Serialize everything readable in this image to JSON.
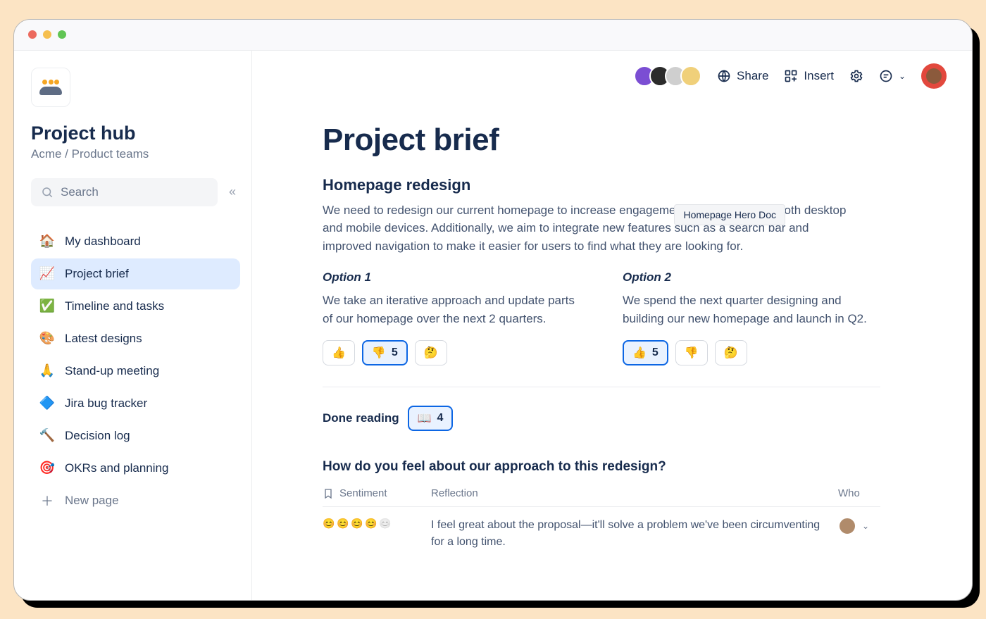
{
  "workspace": {
    "title": "Project hub",
    "breadcrumb": "Acme / Product teams"
  },
  "search": {
    "placeholder": "Search"
  },
  "nav": {
    "items": [
      {
        "icon": "🏠",
        "label": "My dashboard"
      },
      {
        "icon": "📈",
        "label": "Project brief"
      },
      {
        "icon": "✅",
        "label": "Timeline and tasks"
      },
      {
        "icon": "🎨",
        "label": "Latest designs"
      },
      {
        "icon": "🙏",
        "label": "Stand-up meeting"
      },
      {
        "icon": "🔷",
        "label": "Jira bug tracker"
      },
      {
        "icon": "🔨",
        "label": "Decision log"
      },
      {
        "icon": "🎯",
        "label": "OKRs and planning"
      }
    ],
    "new_page": "New page"
  },
  "topbar": {
    "share": "Share",
    "insert": "Insert"
  },
  "collaborators": [
    {
      "bg": "#7b4ed3"
    },
    {
      "bg": "#2b2b2b"
    },
    {
      "bg": "#d9d9d9"
    },
    {
      "bg": "#f0d07a"
    }
  ],
  "doc": {
    "title": "Project brief",
    "subtitle": "Homepage redesign",
    "intro": "We need to redesign our current homepage to increase engagement and optimize for both desktop and mobile devices. Additionally, we aim to integrate new features such as a search bar and improved navigation to make it easier for users to find what they are looking for.",
    "option1": {
      "title": "Option 1",
      "desc": "We take an iterative approach and update parts of our homepage over the next 2 quarters.",
      "reactions": {
        "up": "",
        "down": "5",
        "think": ""
      }
    },
    "option2": {
      "title": "Option 2",
      "desc": "We spend the next quarter designing and building our new homepage and launch in Q2.",
      "reactions": {
        "up": "5",
        "down": "",
        "think": ""
      }
    },
    "done_reading_label": "Done reading",
    "done_reading_count": "4",
    "question": "How do you feel about our approach to this redesign?",
    "table": {
      "col1": "Sentiment",
      "col2": "Reflection",
      "col3": "Who",
      "row1_reflection": "I feel great about the proposal—it'll solve a problem we've been circumventing for a long time."
    }
  },
  "tooltip": "Homepage Hero Doc"
}
